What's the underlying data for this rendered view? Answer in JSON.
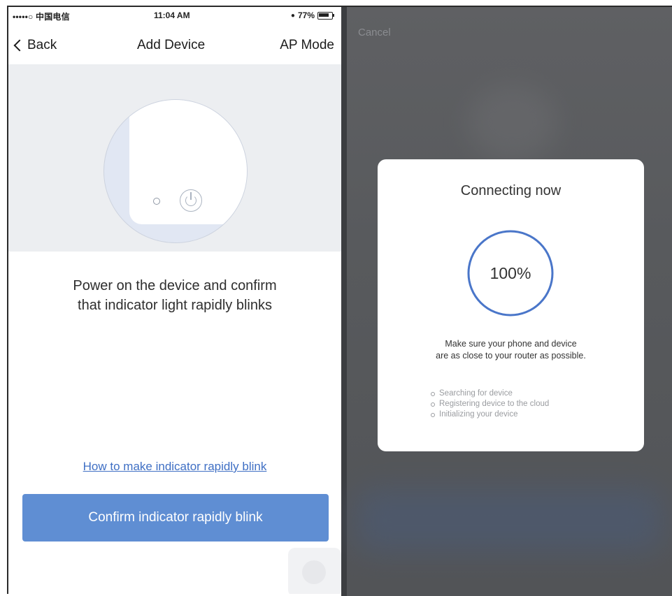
{
  "left_screen": {
    "status_bar": {
      "carrier": "•••••○ 中国电信",
      "time": "11:04 AM",
      "battery": "77%"
    },
    "nav": {
      "back_label": "Back",
      "title": "Add Device",
      "right_label": "AP Mode"
    },
    "instruction_line1": "Power on the device and confirm",
    "instruction_line2": "that indicator light rapidly blinks",
    "help_link": "How to make indicator rapidly blink",
    "confirm_button": "Confirm indicator rapidly blink"
  },
  "right_screen": {
    "cancel_label": "Cancel",
    "dialog": {
      "title": "Connecting now",
      "progress_text": "100%",
      "progress": 1.0,
      "note_line1": "Make sure your phone and device",
      "note_line2": "are as close to your router as possible.",
      "steps": [
        "Searching for device",
        "Registering device to the cloud",
        "Initializing your device"
      ]
    }
  },
  "colors": {
    "accent": "#5f8ed3",
    "link": "#3f6fc4",
    "progress_ring": "#4a76c9",
    "overlay": "#585a5d"
  }
}
